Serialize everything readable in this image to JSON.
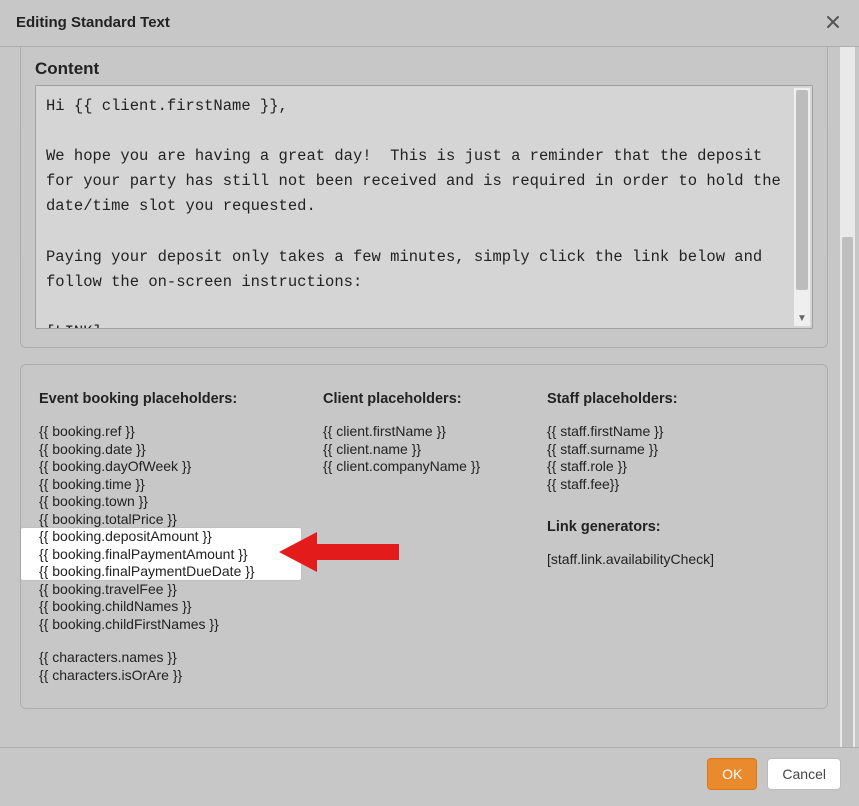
{
  "modal": {
    "title": "Editing Standard Text",
    "ok": "OK",
    "cancel": "Cancel"
  },
  "content": {
    "label": "Content",
    "text": "Hi {{ client.firstName }},\n\nWe hope you are having a great day!  This is just a reminder that the deposit for your party has still not been received and is required in order to hold the date/time slot you requested.\n\nPaying your deposit only takes a few minutes, simply click the link below and follow the on-screen instructions:\n\n[LINK]"
  },
  "placeholders": {
    "event": {
      "heading": "Event booking placeholders:",
      "items": [
        "{{ booking.ref }}",
        "{{ booking.date }}",
        "{{ booking.dayOfWeek }}",
        "{{ booking.time }}",
        "{{ booking.town }}",
        "{{ booking.totalPrice }}",
        "{{ booking.depositAmount }}",
        "{{ booking.finalPaymentAmount }}",
        "{{ booking.finalPaymentDueDate }}",
        "{{ booking.travelFee }}",
        "{{ booking.childNames }}",
        "{{ booking.childFirstNames }}"
      ],
      "items2": [
        "{{ characters.names }}",
        "{{ characters.isOrAre }}"
      ]
    },
    "client": {
      "heading": "Client placeholders:",
      "items": [
        "{{ client.firstName }}",
        "{{ client.name }}",
        "{{ client.companyName }}"
      ]
    },
    "staff": {
      "heading": "Staff placeholders:",
      "items": [
        "{{ staff.firstName }}",
        "{{ staff.surname }}",
        "{{ staff.role }}",
        "{{ staff.fee}}"
      ],
      "links_heading": "Link generators:",
      "links_items": [
        "[staff.link.availabilityCheck]"
      ]
    }
  }
}
